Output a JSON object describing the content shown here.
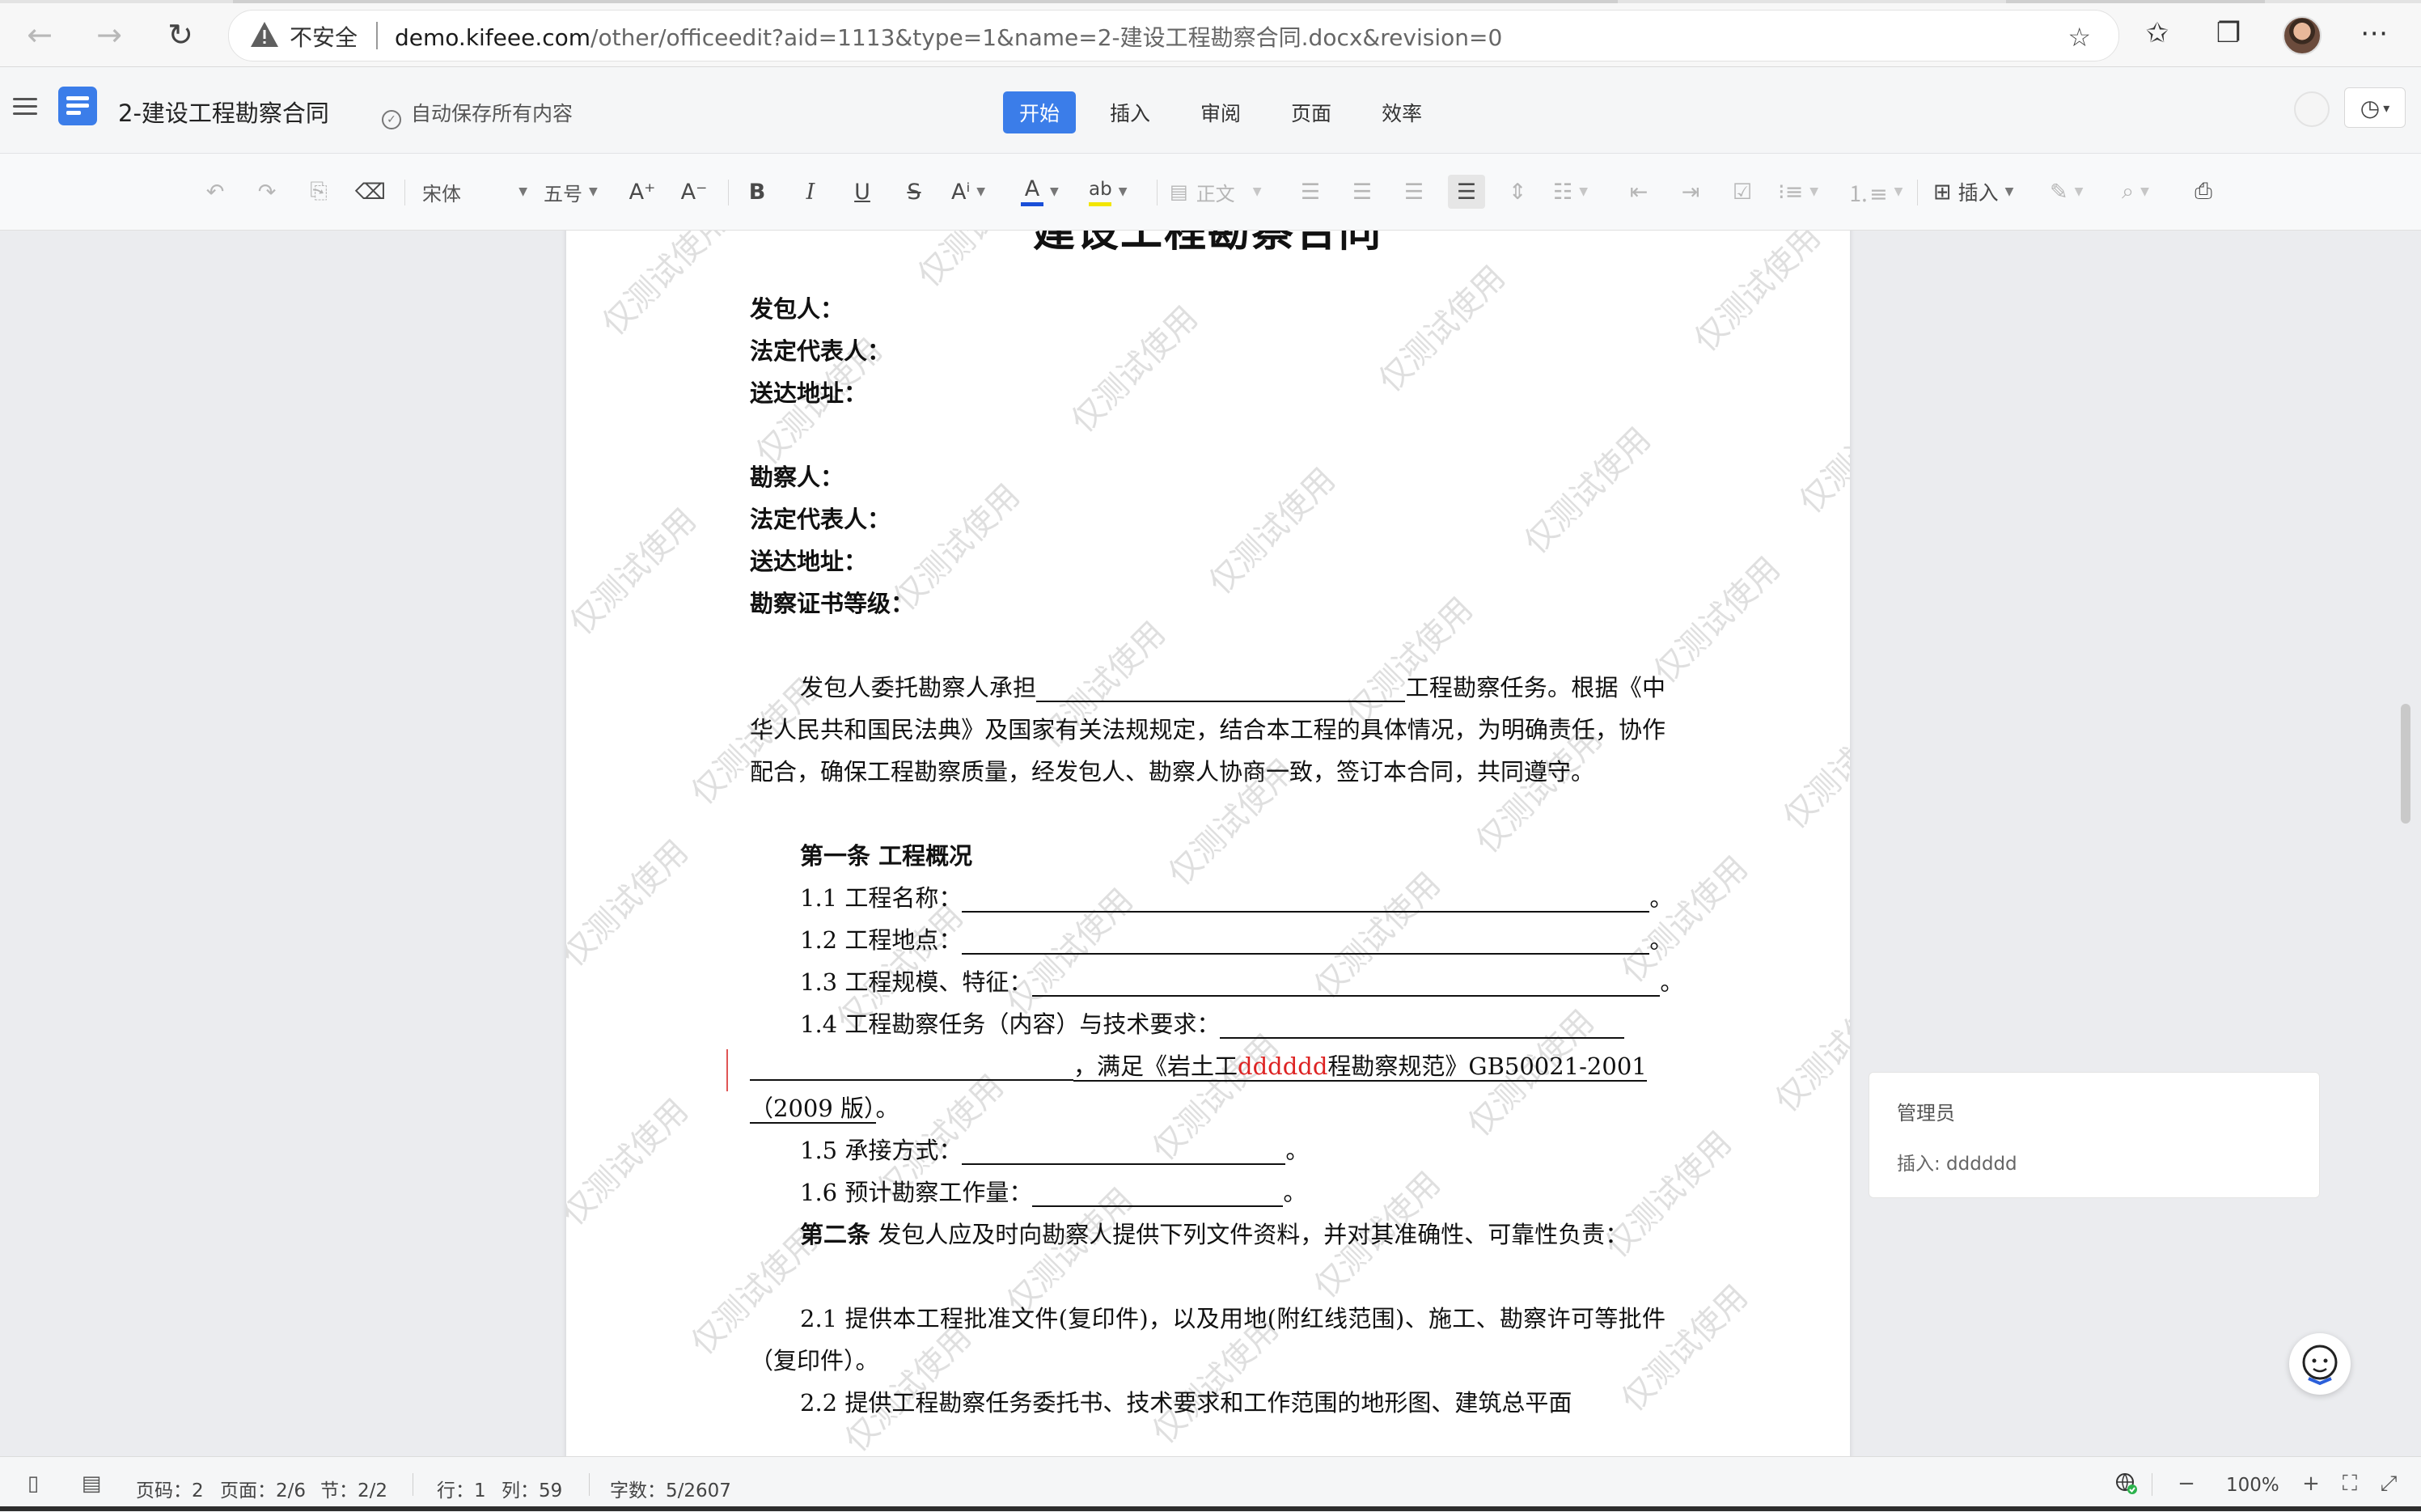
{
  "browser": {
    "insecure_label": "不安全",
    "url_host": "demo.kifeee.com",
    "url_path": "/other/officeedit?aid=1113&type=1&name=2-建设工程勘察合同.docx&revision=0"
  },
  "header": {
    "doc_title": "2-建设工程勘察合同",
    "autosave": "自动保存所有内容",
    "tabs": [
      "开始",
      "插入",
      "审阅",
      "页面",
      "效率"
    ],
    "active_tab": "开始"
  },
  "toolbar": {
    "font_name": "宋体",
    "font_size": "五号",
    "style_name": "正文",
    "insert_label": "插入",
    "font_color": "#1a4fd8",
    "highlight_color": "#f2e600"
  },
  "document": {
    "heading": "建设工程勘察合同",
    "party_a": [
      "发包人：",
      "法定代表人：",
      "送达地址："
    ],
    "party_b": [
      "勘察人：",
      "法定代表人：",
      "送达地址：",
      "勘察证书等级："
    ],
    "intro_start": "发包人委托勘察人承担",
    "intro_rest": "工程勘察任务。根据《中华人民共和国民法典》及国家有关法规规定，结合本工程的具体情况，为明确责任，协作配合，确保工程勘察质量，经发包人、勘察人协商一致，签订本合同，共同遵守。",
    "art1_title": "第一条  工程概况",
    "item_1_1": "1.1 工程名称：",
    "item_1_2": "1.2 工程地点：",
    "item_1_3": "1.3 工程规模、特征：",
    "item_1_4": "1.4 工程勘察任务（内容）与技术要求：",
    "item_1_4_b1": "，满足《岩土工",
    "item_1_4_ins": "dddddd",
    "item_1_4_b2": "程勘察规范》GB50021-2001",
    "item_1_4_c": "（2009 版）",
    "item_1_5": "1.5 承接方式：",
    "item_1_6": "1.6 预计勘察工作量：",
    "period": "。",
    "art2_head": "第二条",
    "art2_rest": " 发包人应及时向勘察人提供下列文件资料，并对其准确性、可靠性负责：",
    "item_2_1": "2.1 提供本工程批准文件(复印件)，以及用地(附红线范围)、施工、勘察许可等批件（复印件）。",
    "item_2_2": "2.2 提供工程勘察任务委托书、技术要求和工作范围的地形图、建筑总平面",
    "watermark": "仅测试使用"
  },
  "comment": {
    "author": "管理员",
    "text": "插入: dddddd"
  },
  "status": {
    "page_code": "页码：2",
    "page": "页面：2/6",
    "section": "节：2/2",
    "row": "行：1",
    "col": "列：59",
    "words": "字数：5/2607",
    "zoom": "100%"
  }
}
